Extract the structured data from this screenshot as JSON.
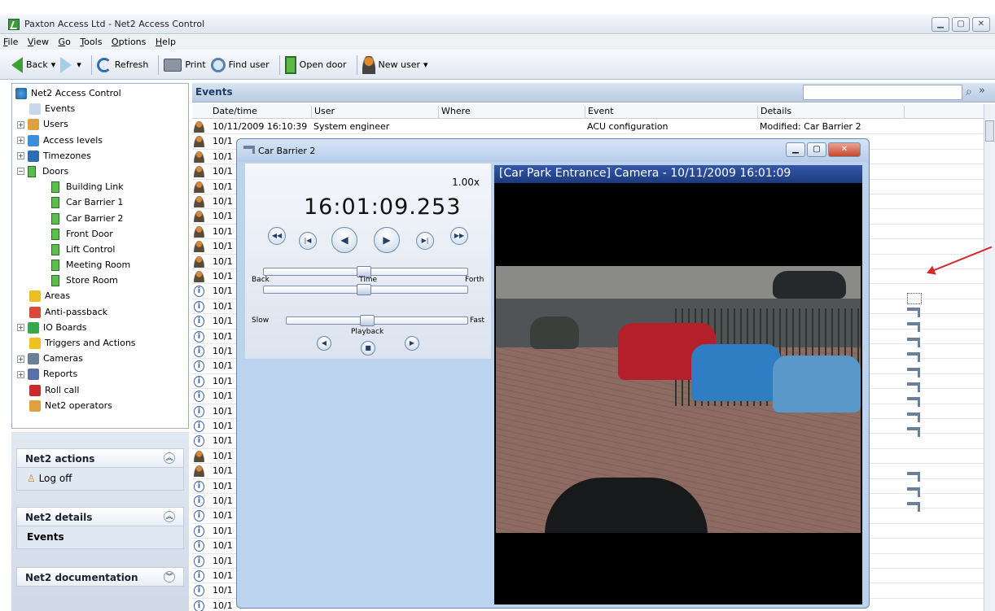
{
  "window": {
    "title": "Paxton Access Ltd - Net2 Access Control"
  },
  "menu": [
    "File",
    "View",
    "Go",
    "Tools",
    "Options",
    "Help"
  ],
  "toolbar": {
    "back": "Back",
    "refresh": "Refresh",
    "print": "Print",
    "find_user": "Find user",
    "open_door": "Open door",
    "new_user": "New user"
  },
  "tree": {
    "root": "Net2 Access Control",
    "items": [
      {
        "label": "Events",
        "level": 1
      },
      {
        "label": "Users",
        "level": 0,
        "expander": "+"
      },
      {
        "label": "Access levels",
        "level": 0,
        "expander": "+"
      },
      {
        "label": "Timezones",
        "level": 0,
        "expander": "+"
      },
      {
        "label": "Doors",
        "level": 0,
        "expander": "-"
      },
      {
        "label": "Building Link",
        "level": 2
      },
      {
        "label": "Car Barrier 1",
        "level": 2
      },
      {
        "label": "Car Barrier 2",
        "level": 2
      },
      {
        "label": "Front Door",
        "level": 2
      },
      {
        "label": "Lift Control",
        "level": 2
      },
      {
        "label": "Meeting Room",
        "level": 2
      },
      {
        "label": "Store Room",
        "level": 2
      },
      {
        "label": "Areas",
        "level": 1
      },
      {
        "label": "Anti-passback",
        "level": 1
      },
      {
        "label": "IO Boards",
        "level": 0,
        "expander": "+"
      },
      {
        "label": "Triggers and Actions",
        "level": 1
      },
      {
        "label": "Cameras",
        "level": 0,
        "expander": "+"
      },
      {
        "label": "Reports",
        "level": 0,
        "expander": "+"
      },
      {
        "label": "Roll call",
        "level": 1
      },
      {
        "label": "Net2 operators",
        "level": 1
      }
    ]
  },
  "actions": {
    "net2_actions": "Net2 actions",
    "log_off": "Log off",
    "net2_details": "Net2 details",
    "details_item": "Events",
    "net2_documentation": "Net2 documentation"
  },
  "events": {
    "title": "Events",
    "columns": [
      "Date/time",
      "User",
      "Where",
      "Event",
      "Details"
    ],
    "first_row": {
      "datetime": "10/11/2009 16:10:39",
      "user": "System engineer",
      "where": "",
      "event": "ACU configuration",
      "details": "Modified: Car Barrier 2"
    },
    "row_date_prefix": "10/1"
  },
  "camera_window": {
    "title": "Car Barrier 2",
    "speed": "1.00x",
    "time": "16:01:09.253",
    "back": "Back",
    "time_label": "Time",
    "forth": "Forth",
    "slow": "Slow",
    "fast": "Fast",
    "playback": "Playback",
    "caption": "[Car Park Entrance] Camera   - 10/11/2009 16:01:09"
  }
}
